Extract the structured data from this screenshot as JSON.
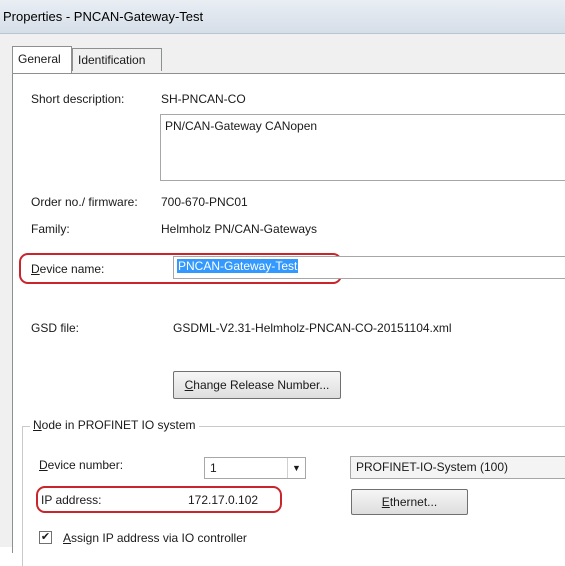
{
  "window": {
    "title": "Properties - PNCAN-Gateway-Test"
  },
  "tabs": [
    {
      "label": "General",
      "active": true
    },
    {
      "label": "Identification",
      "active": false
    }
  ],
  "general": {
    "short_description_label": "Short description:",
    "short_description_value": "SH-PNCAN-CO",
    "description_text": "PN/CAN-Gateway CANopen",
    "order_label": "Order no./ firmware:",
    "order_value": "700-670-PNC01",
    "family_label": "Family:",
    "family_value": "Helmholz PN/CAN-Gateways",
    "device_name_label": "Device name:",
    "device_name_value": "PNCAN-Gateway-Test",
    "gsd_label": "GSD file:",
    "gsd_value": "GSDML-V2.31-Helmholz-PNCAN-CO-20151104.xml",
    "change_release_button": "Change Release Number..."
  },
  "node_group": {
    "title": "Node in PROFINET IO system",
    "device_number_label": "Device number:",
    "device_number_value": "1",
    "io_system_value": "PROFINET-IO-System (100)",
    "ip_label": "IP address:",
    "ip_value": "172.17.0.102",
    "ethernet_button": "Ethernet...",
    "assign_ip_label": "Assign IP address via IO controller",
    "assign_ip_checked": true
  },
  "colors": {
    "highlight_oval": "#c8252c",
    "selection": "#3399ff"
  }
}
